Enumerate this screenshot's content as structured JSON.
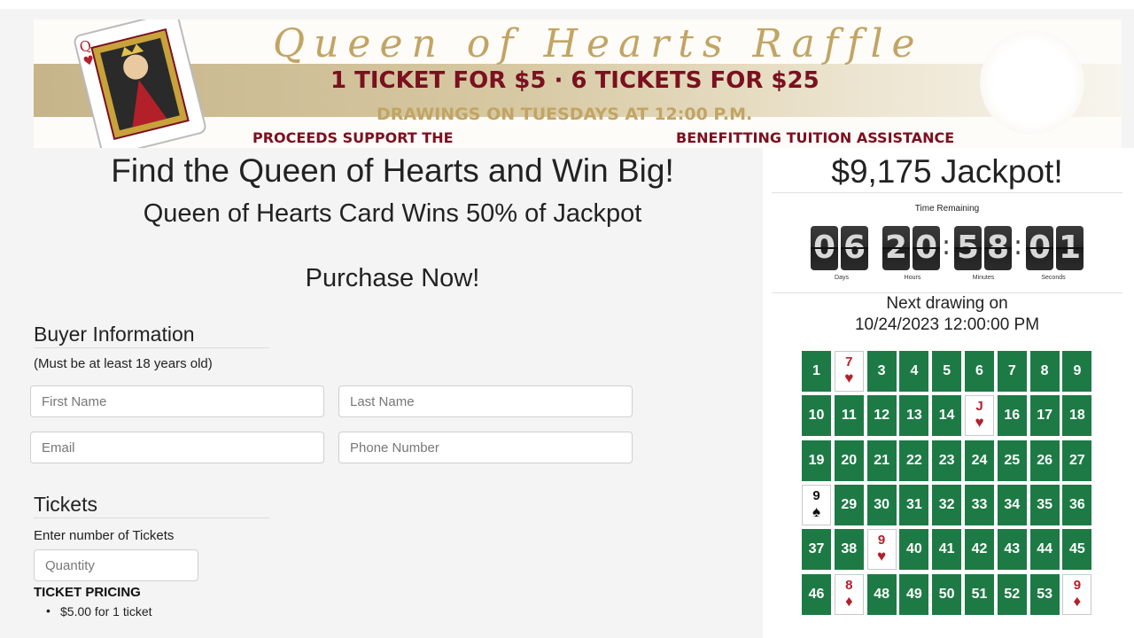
{
  "banner": {
    "title": "Queen of Hearts Raffle",
    "pricing_line": "1 TICKET FOR $5 · 6 TICKETS FOR $25",
    "drawing_line": "DRAWINGS ON TUESDAYS AT 12:00 P.M.",
    "proceeds_left": "PROCEEDS SUPPORT THE",
    "proceeds_right": "BENEFITTING TUITION ASSISTANCE",
    "card_rank": "Q",
    "card_suit": "♥"
  },
  "headings": {
    "main": "Find the Queen of Hearts and Win Big!",
    "sub": "Queen of Hearts Card Wins 50% of Jackpot",
    "cta": "Purchase Now!"
  },
  "buyer": {
    "title": "Buyer Information",
    "note": "(Must be at least 18 years old)",
    "first_name_placeholder": "First Name",
    "last_name_placeholder": "Last Name",
    "email_placeholder": "Email",
    "phone_placeholder": "Phone Number"
  },
  "tickets": {
    "title": "Tickets",
    "label": "Enter number of Tickets",
    "quantity_placeholder": "Quantity",
    "pricing_title": "TICKET PRICING",
    "pricing_items": [
      "$5.00 for 1 ticket"
    ]
  },
  "jackpot": {
    "amount_text": "$9,175 Jackpot!",
    "time_remaining_label": "Time Remaining",
    "countdown": {
      "days": [
        "0",
        "6"
      ],
      "hours": [
        "2",
        "0"
      ],
      "minutes": [
        "5",
        "8"
      ],
      "seconds": [
        "0",
        "1"
      ],
      "labels": [
        "Days",
        "Hours",
        "Minutes",
        "Seconds"
      ]
    },
    "next_drawing_label": "Next drawing on",
    "next_drawing_date": "10/24/2023 12:00:00 PM"
  },
  "board": {
    "colors": {
      "unrevealed": "#1e7a45",
      "red_suit": "#b3202a",
      "black_suit": "#111111"
    },
    "cells": [
      {
        "n": "1"
      },
      {
        "rank": "7",
        "suit": "♥",
        "color": "red"
      },
      {
        "n": "3"
      },
      {
        "n": "4"
      },
      {
        "n": "5"
      },
      {
        "n": "6"
      },
      {
        "n": "7"
      },
      {
        "n": "8"
      },
      {
        "n": "9"
      },
      {
        "n": "10"
      },
      {
        "n": "11"
      },
      {
        "n": "12"
      },
      {
        "n": "13"
      },
      {
        "n": "14"
      },
      {
        "rank": "J",
        "suit": "♥",
        "color": "red"
      },
      {
        "n": "16"
      },
      {
        "n": "17"
      },
      {
        "n": "18"
      },
      {
        "n": "19"
      },
      {
        "n": "20"
      },
      {
        "n": "21"
      },
      {
        "n": "22"
      },
      {
        "n": "23"
      },
      {
        "n": "24"
      },
      {
        "n": "25"
      },
      {
        "n": "26"
      },
      {
        "n": "27"
      },
      {
        "rank": "9",
        "suit": "♠",
        "color": "black"
      },
      {
        "n": "29"
      },
      {
        "n": "30"
      },
      {
        "n": "31"
      },
      {
        "n": "32"
      },
      {
        "n": "33"
      },
      {
        "n": "34"
      },
      {
        "n": "35"
      },
      {
        "n": "36"
      },
      {
        "n": "37"
      },
      {
        "n": "38"
      },
      {
        "rank": "9",
        "suit": "♥",
        "color": "red"
      },
      {
        "n": "40"
      },
      {
        "n": "41"
      },
      {
        "n": "42"
      },
      {
        "n": "43"
      },
      {
        "n": "44"
      },
      {
        "n": "45"
      },
      {
        "n": "46"
      },
      {
        "rank": "8",
        "suit": "♦",
        "color": "red"
      },
      {
        "n": "48"
      },
      {
        "n": "49"
      },
      {
        "n": "50"
      },
      {
        "n": "51"
      },
      {
        "n": "52"
      },
      {
        "n": "53"
      },
      {
        "rank": "9",
        "suit": "♦",
        "color": "red"
      }
    ]
  }
}
